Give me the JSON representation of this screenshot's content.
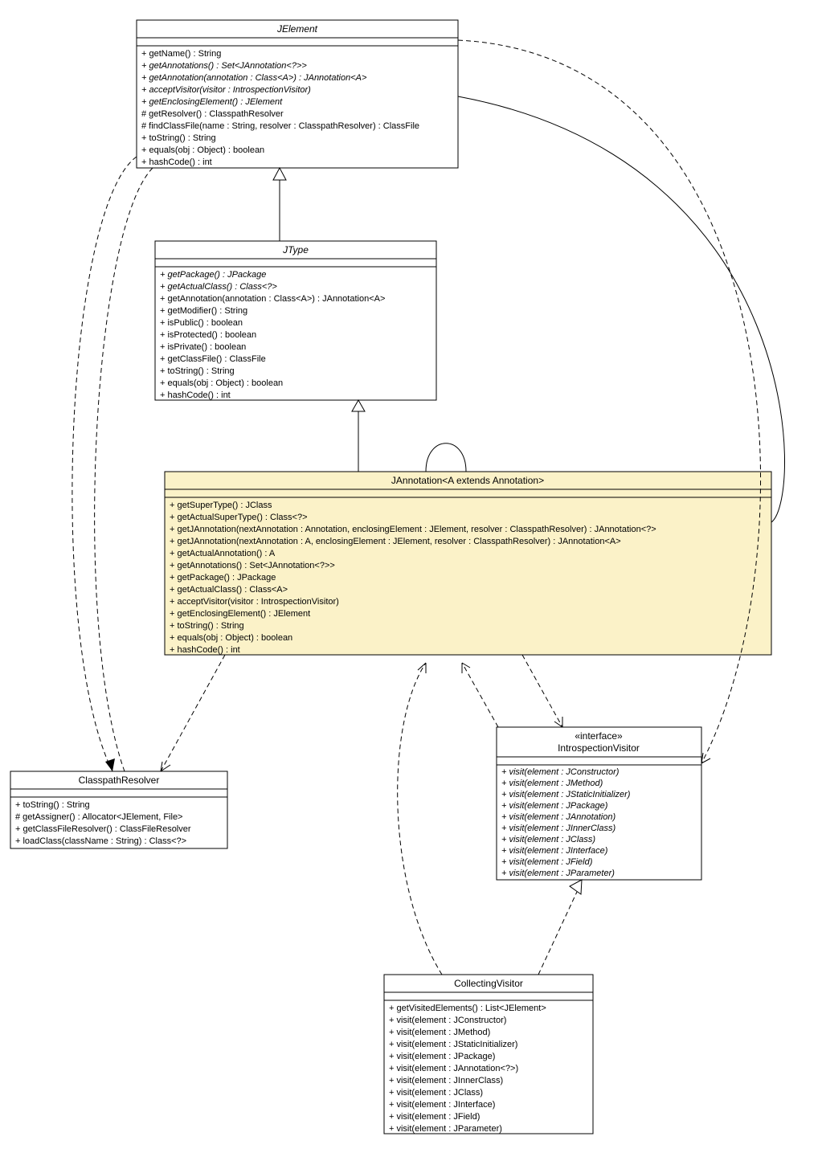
{
  "classes": {
    "JElement": {
      "title": "JElement",
      "titleItalic": true,
      "members": [
        {
          "text": "+ getName() : String",
          "italic": false
        },
        {
          "text": "+ getAnnotations() : Set<JAnnotation<?>>",
          "italic": true
        },
        {
          "text": "+ getAnnotation(annotation : Class<A>) : JAnnotation<A>",
          "italic": true
        },
        {
          "text": "+ acceptVisitor(visitor : IntrospectionVisitor)",
          "italic": true
        },
        {
          "text": "+ getEnclosingElement() : JElement",
          "italic": true
        },
        {
          "text": "# getResolver() : ClasspathResolver",
          "italic": false
        },
        {
          "text": "# findClassFile(name : String, resolver : ClasspathResolver) : ClassFile",
          "italic": false
        },
        {
          "text": "+ toString() : String",
          "italic": false
        },
        {
          "text": "+ equals(obj : Object) : boolean",
          "italic": false
        },
        {
          "text": "+ hashCode() : int",
          "italic": false
        }
      ]
    },
    "JType": {
      "title": "JType",
      "titleItalic": true,
      "members": [
        {
          "text": "+ getPackage() : JPackage",
          "italic": true
        },
        {
          "text": "+ getActualClass() : Class<?>",
          "italic": true
        },
        {
          "text": "+ getAnnotation(annotation : Class<A>) : JAnnotation<A>",
          "italic": false
        },
        {
          "text": "+ getModifier() : String",
          "italic": false
        },
        {
          "text": "+ isPublic() : boolean",
          "italic": false
        },
        {
          "text": "+ isProtected() : boolean",
          "italic": false
        },
        {
          "text": "+ isPrivate() : boolean",
          "italic": false
        },
        {
          "text": "+ getClassFile() : ClassFile",
          "italic": false
        },
        {
          "text": "+ toString() : String",
          "italic": false
        },
        {
          "text": "+ equals(obj : Object) : boolean",
          "italic": false
        },
        {
          "text": "+ hashCode() : int",
          "italic": false
        }
      ]
    },
    "JAnnotation": {
      "title": "JAnnotation<A extends Annotation>",
      "titleItalic": false,
      "highlight": true,
      "members": [
        {
          "text": "+ getSuperType() : JClass",
          "italic": false
        },
        {
          "text": "+ getActualSuperType() : Class<?>",
          "italic": false
        },
        {
          "text": "+ getJAnnotation(nextAnnotation : Annotation, enclosingElement : JElement, resolver : ClasspathResolver) : JAnnotation<?>",
          "italic": false
        },
        {
          "text": "+ getJAnnotation(nextAnnotation : A, enclosingElement : JElement, resolver : ClasspathResolver) : JAnnotation<A>",
          "italic": false
        },
        {
          "text": "+ getActualAnnotation() : A",
          "italic": false
        },
        {
          "text": "+ getAnnotations() : Set<JAnnotation<?>>",
          "italic": false
        },
        {
          "text": "+ getPackage() : JPackage",
          "italic": false
        },
        {
          "text": "+ getActualClass() : Class<A>",
          "italic": false
        },
        {
          "text": "+ acceptVisitor(visitor : IntrospectionVisitor)",
          "italic": false
        },
        {
          "text": "+ getEnclosingElement() : JElement",
          "italic": false
        },
        {
          "text": "+ toString() : String",
          "italic": false
        },
        {
          "text": "+ equals(obj : Object) : boolean",
          "italic": false
        },
        {
          "text": "+ hashCode() : int",
          "italic": false
        }
      ]
    },
    "ClasspathResolver": {
      "title": "ClasspathResolver",
      "titleItalic": false,
      "members": [
        {
          "text": "+ toString() : String",
          "italic": false
        },
        {
          "text": "# getAssigner() : Allocator<JElement, File>",
          "italic": false
        },
        {
          "text": "+ getClassFileResolver() : ClassFileResolver",
          "italic": false
        },
        {
          "text": "+ loadClass(className : String) : Class<?>",
          "italic": false
        }
      ]
    },
    "IntrospectionVisitor": {
      "stereotype": "«interface»",
      "title": "IntrospectionVisitor",
      "titleItalic": false,
      "members": [
        {
          "text": "+ visit(element : JConstructor)",
          "italic": true
        },
        {
          "text": "+ visit(element : JMethod)",
          "italic": true
        },
        {
          "text": "+ visit(element : JStaticInitializer)",
          "italic": true
        },
        {
          "text": "+ visit(element : JPackage)",
          "italic": true
        },
        {
          "text": "+ visit(element : JAnnotation)",
          "italic": true
        },
        {
          "text": "+ visit(element : JInnerClass)",
          "italic": true
        },
        {
          "text": "+ visit(element : JClass)",
          "italic": true
        },
        {
          "text": "+ visit(element : JInterface)",
          "italic": true
        },
        {
          "text": "+ visit(element : JField)",
          "italic": true
        },
        {
          "text": "+ visit(element : JParameter)",
          "italic": true
        }
      ]
    },
    "CollectingVisitor": {
      "title": "CollectingVisitor",
      "titleItalic": false,
      "members": [
        {
          "text": "+ getVisitedElements() : List<JElement>",
          "italic": false
        },
        {
          "text": "+ visit(element : JConstructor)",
          "italic": false
        },
        {
          "text": "+ visit(element : JMethod)",
          "italic": false
        },
        {
          "text": "+ visit(element : JStaticInitializer)",
          "italic": false
        },
        {
          "text": "+ visit(element : JPackage)",
          "italic": false
        },
        {
          "text": "+ visit(element : JAnnotation<?>)",
          "italic": false
        },
        {
          "text": "+ visit(element : JInnerClass)",
          "italic": false
        },
        {
          "text": "+ visit(element : JClass)",
          "italic": false
        },
        {
          "text": "+ visit(element : JInterface)",
          "italic": false
        },
        {
          "text": "+ visit(element : JField)",
          "italic": false
        },
        {
          "text": "+ visit(element : JParameter)",
          "italic": false
        }
      ]
    }
  }
}
